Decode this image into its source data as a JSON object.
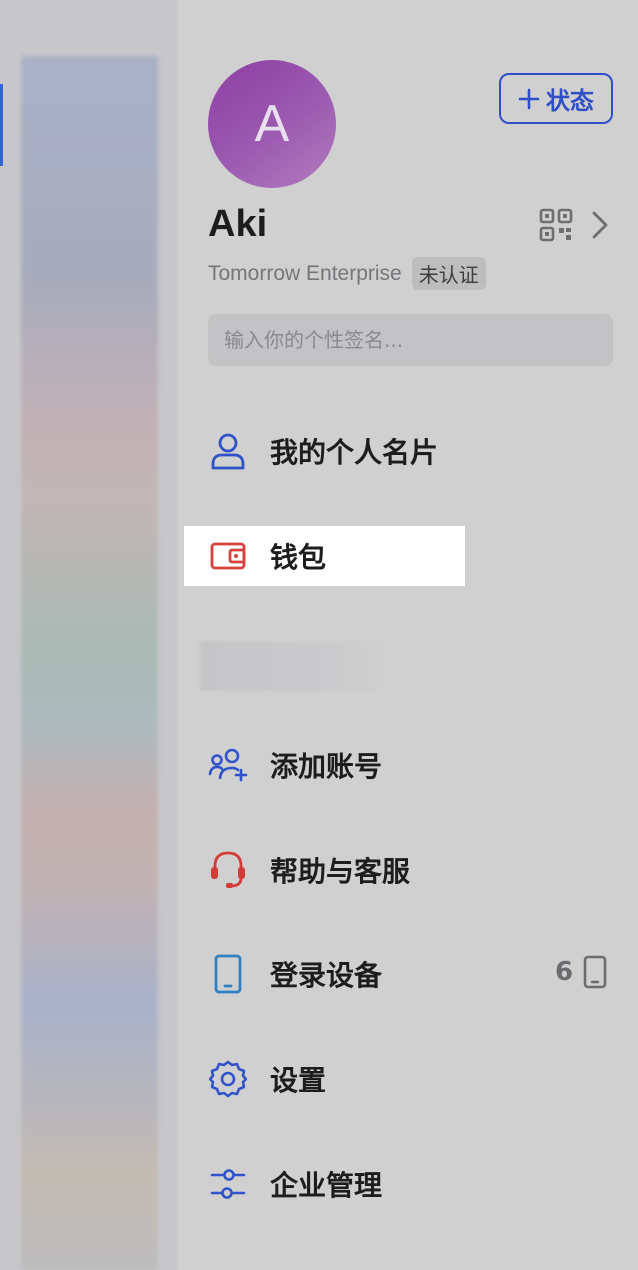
{
  "profile": {
    "avatar_letter": "A",
    "name": "Aki",
    "org_name": "Tomorrow Enterprise",
    "verify_badge": "未认证",
    "signature_placeholder": "输入你的个性签名..."
  },
  "status_button": {
    "label": "状态",
    "icon": "plus-icon"
  },
  "menu": {
    "card": "我的个人名片",
    "wallet": "钱包",
    "add_account": "添加账号",
    "help": "帮助与客服",
    "devices": "登录设备",
    "devices_count": "6",
    "settings": "设置",
    "enterprise": "企业管理"
  },
  "colors": {
    "accent_blue": "#2f4fc9",
    "wallet_red": "#d9423a",
    "help_red": "#d33c37",
    "device_blue": "#2f7fc4",
    "avatar_purple": "#9a55ad"
  }
}
